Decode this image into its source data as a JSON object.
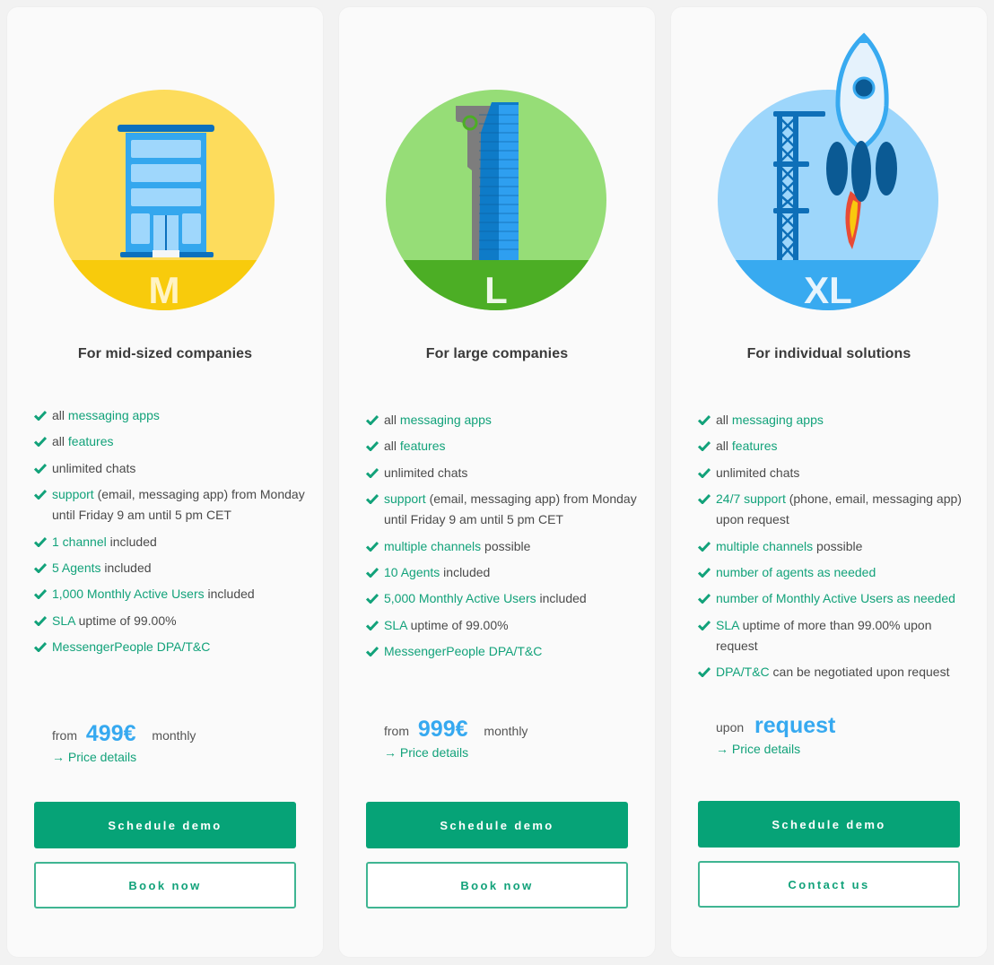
{
  "colors": {
    "accent_green": "#06a377",
    "link_green": "#12a27a",
    "price_blue": "#36a9f0",
    "card_bg": "#fafafa",
    "page_bg": "#f2f2f2"
  },
  "plans": [
    {
      "size_label": "M",
      "illustration": "office-building-icon",
      "title": "For mid-sized companies",
      "features": [
        {
          "pre": "all ",
          "hl": "messaging apps",
          "post": ""
        },
        {
          "pre": "all ",
          "hl": "features",
          "post": ""
        },
        {
          "pre": "unlimited chats",
          "hl": "",
          "post": ""
        },
        {
          "pre": "",
          "hl": "support",
          "post": " (email, messaging app) from Monday until Friday 9 am until 5 pm CET"
        },
        {
          "pre": "",
          "hl": "1 channel",
          "post": " included"
        },
        {
          "pre": "",
          "hl": "5 Agents",
          "post": " included"
        },
        {
          "pre": "",
          "hl": "1,000 Monthly Active Users",
          "post": " included"
        },
        {
          "pre": "",
          "hl": "SLA",
          "post": " uptime of 99.00%"
        },
        {
          "pre": "",
          "hl": "MessengerPeople DPA/T&C",
          "post": ""
        }
      ],
      "price_prefix": "from",
      "price_amount": "499€",
      "price_suffix": "monthly",
      "price_link": "→ Price details",
      "primary_button": "Schedule demo",
      "secondary_button": "Book now"
    },
    {
      "size_label": "L",
      "illustration": "skyscraper-icon",
      "title": "For large companies",
      "features": [
        {
          "pre": "all ",
          "hl": "messaging apps",
          "post": ""
        },
        {
          "pre": "all ",
          "hl": "features",
          "post": ""
        },
        {
          "pre": "unlimited chats",
          "hl": "",
          "post": ""
        },
        {
          "pre": "",
          "hl": "support",
          "post": " (email, messaging app) from Monday until Friday 9 am until 5 pm CET"
        },
        {
          "pre": "",
          "hl": "multiple channels",
          "post": " possible"
        },
        {
          "pre": "",
          "hl": "10 Agents",
          "post": " included"
        },
        {
          "pre": "",
          "hl": "5,000 Monthly Active Users",
          "post": " included"
        },
        {
          "pre": "",
          "hl": "SLA",
          "post": " uptime of 99.00%"
        },
        {
          "pre": "",
          "hl": "MessengerPeople DPA/T&C",
          "post": ""
        }
      ],
      "price_prefix": "from",
      "price_amount": "999€",
      "price_suffix": "monthly",
      "price_link": "→ Price details",
      "primary_button": "Schedule demo",
      "secondary_button": "Book now"
    },
    {
      "size_label": "XL",
      "illustration": "rocket-launch-icon",
      "title": "For individual solutions",
      "features": [
        {
          "pre": "all ",
          "hl": "messaging apps",
          "post": ""
        },
        {
          "pre": "all ",
          "hl": "features",
          "post": ""
        },
        {
          "pre": "unlimited chats",
          "hl": "",
          "post": ""
        },
        {
          "pre": "",
          "hl": "24/7 support",
          "post": " (phone, email, messaging app) upon request"
        },
        {
          "pre": "",
          "hl": "multiple channels",
          "post": " possible"
        },
        {
          "pre": "",
          "hl": "number of agents as needed",
          "post": ""
        },
        {
          "pre": "",
          "hl": "number of Monthly Active Users as needed",
          "post": ""
        },
        {
          "pre": "",
          "hl": "SLA",
          "post": " uptime of more than 99.00% upon request"
        },
        {
          "pre": "",
          "hl": "DPA/T&C",
          "post": " can be negotiated upon request"
        }
      ],
      "price_prefix": "upon",
      "price_amount": "request",
      "price_suffix": "",
      "price_link": "→ Price details",
      "primary_button": "Schedule demo",
      "secondary_button": "Contact us"
    }
  ]
}
